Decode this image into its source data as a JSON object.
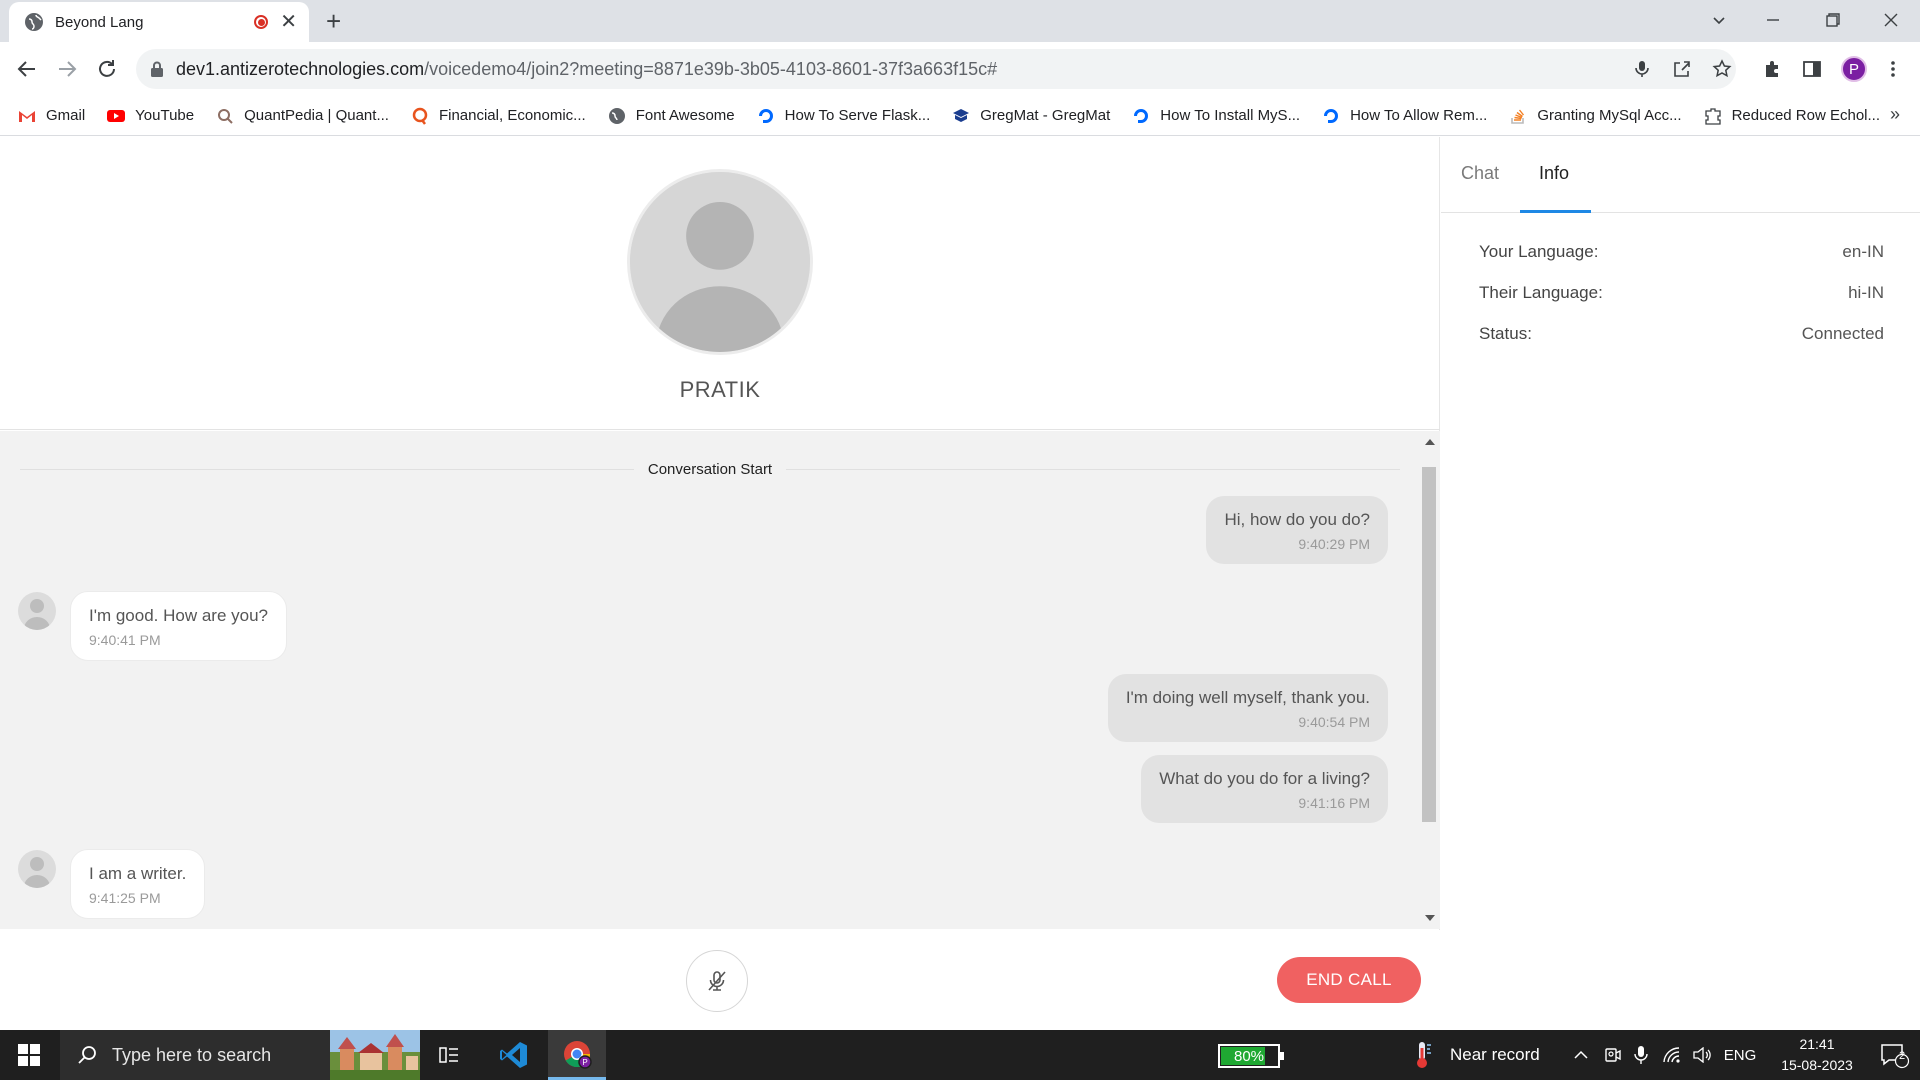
{
  "browser": {
    "tab_title": "Beyond Lang",
    "tab_close": "✕",
    "new_tab": "+",
    "url_host": "dev1.antizerotechnologies.com",
    "url_path": "/voicedemo4/join2?meeting=8871e39b-3b05-4103-8601-37f3a663f15c#",
    "profile_initial": "P",
    "bookmarks": [
      {
        "label": "Gmail",
        "icon": "gmail-icon"
      },
      {
        "label": "YouTube",
        "icon": "youtube-icon"
      },
      {
        "label": "QuantPedia | Quant...",
        "icon": "quantpedia-icon"
      },
      {
        "label": "Financial, Economic...",
        "icon": "quandl-icon"
      },
      {
        "label": "Font Awesome",
        "icon": "globe-icon"
      },
      {
        "label": "How To Serve Flask...",
        "icon": "digitalocean-icon"
      },
      {
        "label": "GregMat - GregMat",
        "icon": "gregmat-icon"
      },
      {
        "label": "How To Install MyS...",
        "icon": "digitalocean-icon"
      },
      {
        "label": "How To Allow Rem...",
        "icon": "digitalocean-icon"
      },
      {
        "label": "Granting MySql Acc...",
        "icon": "stackoverflow-icon"
      },
      {
        "label": "Reduced Row Echol...",
        "icon": "puzzle-icon"
      }
    ],
    "bookmarks_more": "»"
  },
  "call": {
    "peer_name": "PRATIK",
    "conversation_start": "Conversation Start",
    "messages": [
      {
        "direction": "out",
        "text": "Hi, how do you do?",
        "time": "9:40:29 PM"
      },
      {
        "direction": "in",
        "text": "I'm good. How are you?",
        "time": "9:40:41 PM"
      },
      {
        "direction": "out",
        "text": "I'm doing well myself, thank you.",
        "time": "9:40:54 PM"
      },
      {
        "direction": "out",
        "text": "What do you do for a living?",
        "time": "9:41:16 PM"
      },
      {
        "direction": "in",
        "text": "I am a writer.",
        "time": "9:41:25 PM"
      }
    ],
    "end_call_label": "END CALL"
  },
  "sidebar": {
    "tabs": [
      {
        "label": "Chat",
        "active": false
      },
      {
        "label": "Info",
        "active": true
      }
    ],
    "info": [
      {
        "label": "Your Language:",
        "value": "en-IN"
      },
      {
        "label": "Their Language:",
        "value": "hi-IN"
      },
      {
        "label": "Status:",
        "value": "Connected"
      }
    ]
  },
  "taskbar": {
    "search_placeholder": "Type here to search",
    "battery_label": "80%",
    "battery_level": 0.8,
    "weather": "Near record",
    "language": "ENG",
    "time": "21:41",
    "date": "15-08-2023",
    "notification_count": "2"
  },
  "colors": {
    "accent_blue": "#1e88e5",
    "end_call": "#f06161",
    "battery_green": "#1fa832"
  }
}
